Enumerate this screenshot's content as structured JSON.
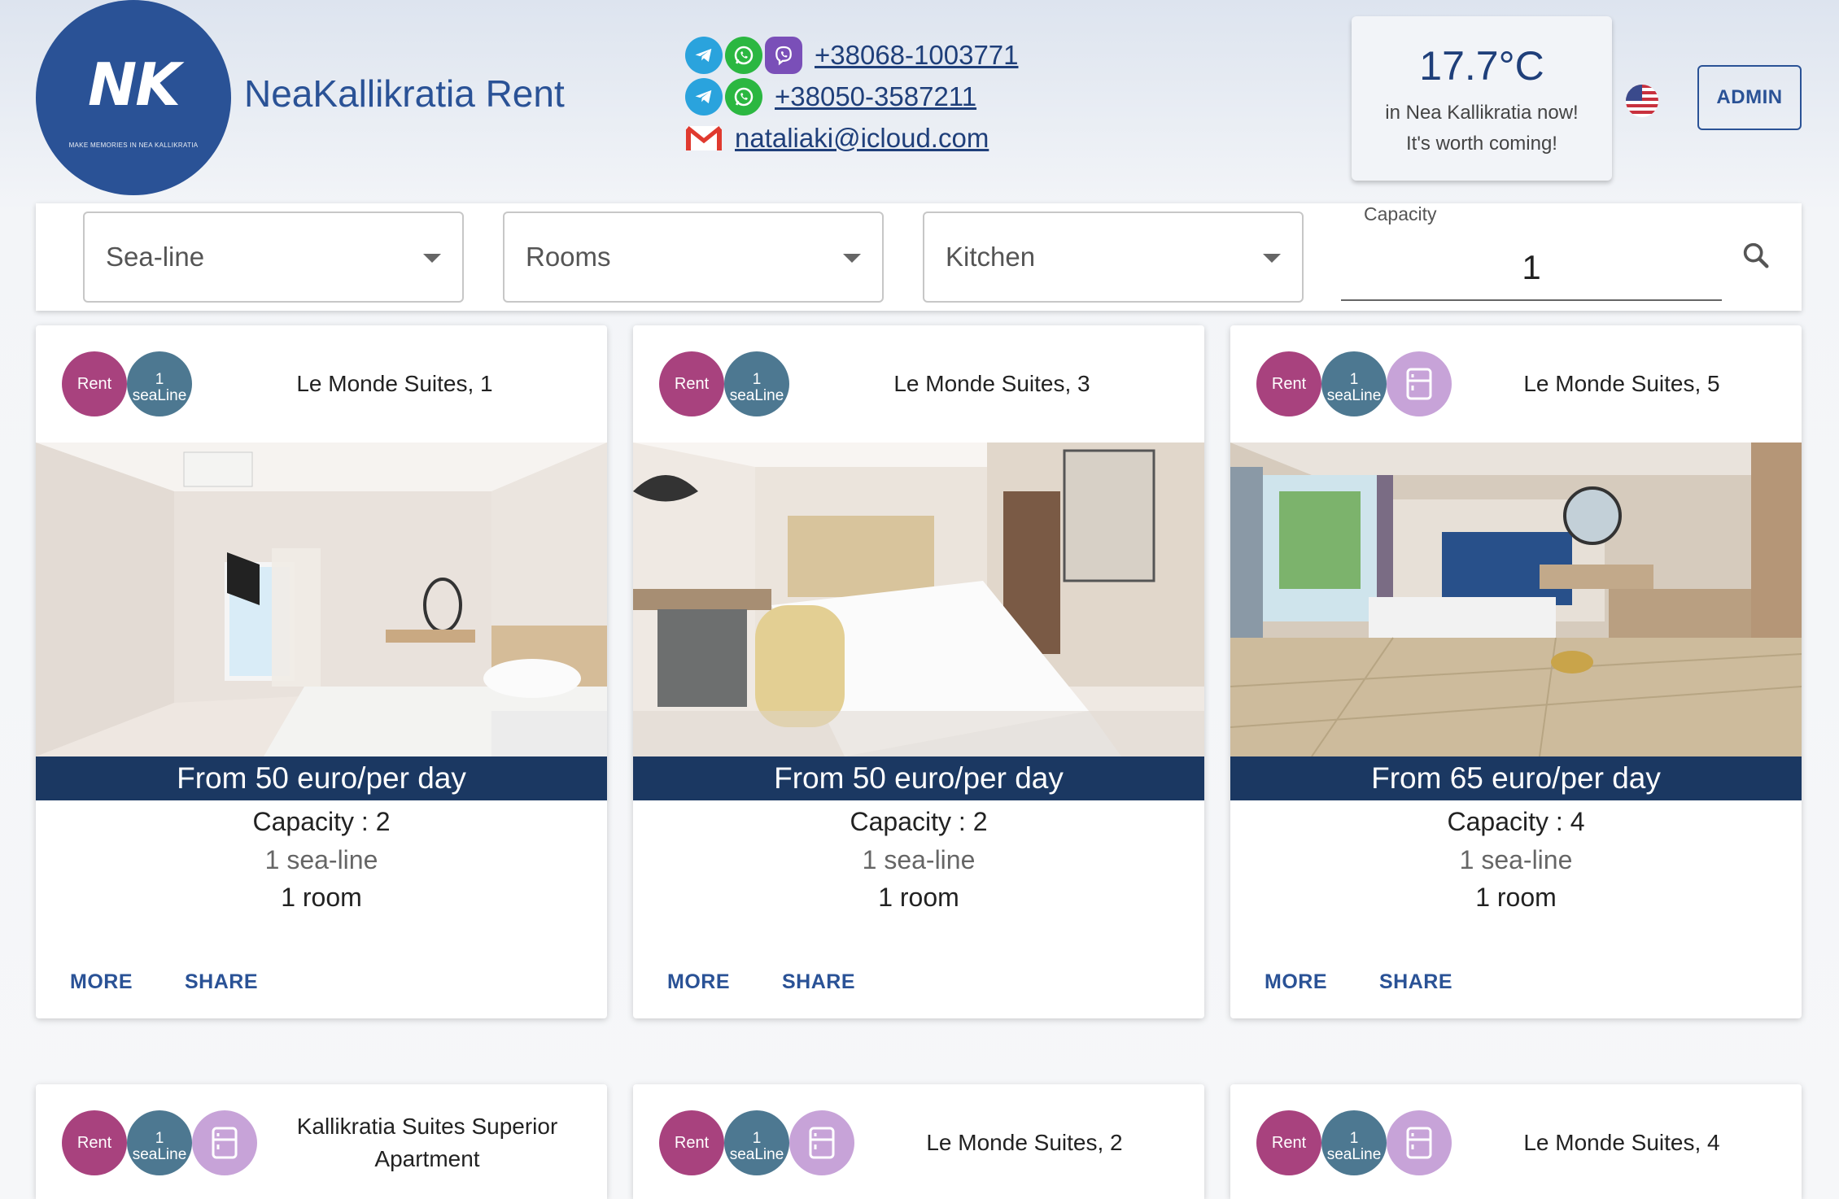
{
  "header": {
    "logo_mark": "NK",
    "logo_tagline": "MAKE MEMORIES IN NEA KALLIKRATIA",
    "brand": "NeaKallikratia Rent",
    "phone_1": "+38068-1003771",
    "phone_2": "+38050-3587211",
    "email": "nataliaki@icloud.com",
    "weather_temp": "17.7°C",
    "weather_line_1": "in Nea Kallikratia now!",
    "weather_line_2": "It's worth coming!",
    "admin_label": "ADMIN"
  },
  "filters": {
    "sea_line": "Sea-line",
    "rooms": "Rooms",
    "kitchen": "Kitchen",
    "capacity_label": "Capacity",
    "capacity_value": "1"
  },
  "colors": {
    "brand_blue": "#2a5296",
    "price_bar": "#1b3862",
    "rent_badge": "#a8427e",
    "sealine_badge": "#4d7891",
    "kitchen_badge": "#c7a3d8"
  },
  "cards": [
    {
      "badge_rent": "Rent",
      "badge_sea_num": "1",
      "badge_sea_text": "seaLine",
      "has_kitchen": false,
      "title": "Le Monde Suites, 1",
      "price": "From 50 euro/per day",
      "capacity": "Capacity : 2",
      "sea_line": "1 sea-line",
      "rooms": "1 room",
      "more": "MORE",
      "share": "SHARE"
    },
    {
      "badge_rent": "Rent",
      "badge_sea_num": "1",
      "badge_sea_text": "seaLine",
      "has_kitchen": false,
      "title": "Le Monde Suites, 3",
      "price": "From 50 euro/per day",
      "capacity": "Capacity : 2",
      "sea_line": "1 sea-line",
      "rooms": "1 room",
      "more": "MORE",
      "share": "SHARE"
    },
    {
      "badge_rent": "Rent",
      "badge_sea_num": "1",
      "badge_sea_text": "seaLine",
      "has_kitchen": true,
      "title": "Le Monde Suites, 5",
      "price": "From 65 euro/per day",
      "capacity": "Capacity : 4",
      "sea_line": "1 sea-line",
      "rooms": "1 room",
      "more": "MORE",
      "share": "SHARE"
    },
    {
      "badge_rent": "Rent",
      "badge_sea_num": "1",
      "badge_sea_text": "seaLine",
      "has_kitchen": true,
      "title": "Kallikratia Suites Superior Apartment"
    },
    {
      "badge_rent": "Rent",
      "badge_sea_num": "1",
      "badge_sea_text": "seaLine",
      "has_kitchen": true,
      "title": "Le Monde Suites, 2"
    },
    {
      "badge_rent": "Rent",
      "badge_sea_num": "1",
      "badge_sea_text": "seaLine",
      "has_kitchen": true,
      "title": "Le Monde Suites, 4"
    }
  ]
}
